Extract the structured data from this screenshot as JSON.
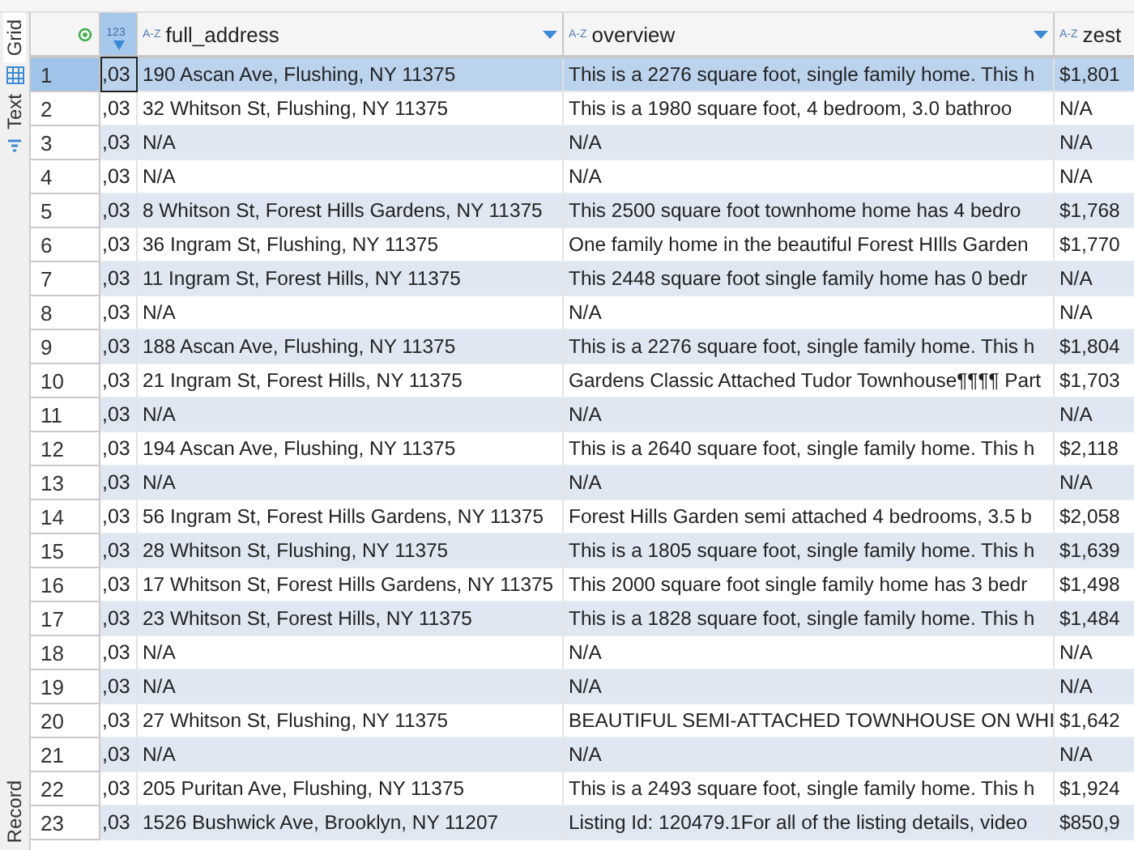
{
  "side_tabs": [
    {
      "label": "Grid",
      "selected": true
    },
    {
      "label": "Text",
      "selected": false
    },
    {
      "label": "Record",
      "selected": false
    }
  ],
  "table": {
    "columns": [
      {
        "kind": "number",
        "type_label": "123"
      },
      {
        "kind": "text",
        "type_label": "A-Z",
        "name": "full_address"
      },
      {
        "kind": "text",
        "type_label": "A-Z",
        "name": "overview"
      },
      {
        "kind": "text",
        "type_label": "A-Z",
        "name": "zest"
      }
    ],
    "rows": [
      {
        "num": "1",
        "selected": true,
        "cells": [
          ",03",
          "190 Ascan Ave, Flushing, NY 11375",
          "This is a 2276 square foot, single family home. This h",
          "$1,801"
        ]
      },
      {
        "num": "2",
        "selected": false,
        "cells": [
          ",03",
          "32 Whitson St, Flushing, NY 11375",
          "This is a 1980 square foot, 4 bedroom, 3.0 bathroo",
          "N/A"
        ]
      },
      {
        "num": "3",
        "selected": false,
        "cells": [
          ",03",
          "N/A",
          "N/A",
          "N/A"
        ]
      },
      {
        "num": "4",
        "selected": false,
        "cells": [
          ",03",
          "N/A",
          "N/A",
          "N/A"
        ]
      },
      {
        "num": "5",
        "selected": false,
        "cells": [
          ",03",
          "8 Whitson St, Forest Hills Gardens, NY 11375",
          "This 2500 square foot townhome home has 4 bedro",
          "$1,768"
        ]
      },
      {
        "num": "6",
        "selected": false,
        "cells": [
          ",03",
          "36 Ingram St, Flushing, NY 11375",
          "One family home in the beautiful Forest HIlls Garden",
          "$1,770"
        ]
      },
      {
        "num": "7",
        "selected": false,
        "cells": [
          ",03",
          "11 Ingram St, Forest Hills, NY 11375",
          "This 2448 square foot single family home has 0 bedr",
          "N/A"
        ]
      },
      {
        "num": "8",
        "selected": false,
        "cells": [
          ",03",
          "N/A",
          "N/A",
          "N/A"
        ]
      },
      {
        "num": "9",
        "selected": false,
        "cells": [
          ",03",
          "188 Ascan Ave, Flushing, NY 11375",
          "This is a 2276 square foot, single family home. This h",
          "$1,804"
        ]
      },
      {
        "num": "10",
        "selected": false,
        "cells": [
          ",03",
          "21 Ingram St, Forest Hills, NY 11375",
          "Gardens Classic Attached Tudor Townhouse¶¶¶¶ Part",
          "$1,703"
        ]
      },
      {
        "num": "11",
        "selected": false,
        "cells": [
          ",03",
          "N/A",
          "N/A",
          "N/A"
        ]
      },
      {
        "num": "12",
        "selected": false,
        "cells": [
          ",03",
          "194 Ascan Ave, Flushing, NY 11375",
          "This is a 2640 square foot, single family home. This h",
          "$2,118"
        ]
      },
      {
        "num": "13",
        "selected": false,
        "cells": [
          ",03",
          "N/A",
          "N/A",
          "N/A"
        ]
      },
      {
        "num": "14",
        "selected": false,
        "cells": [
          ",03",
          "56 Ingram St, Forest Hills Gardens, NY 11375",
          "Forest Hills Garden semi attached 4 bedrooms, 3.5 b",
          "$2,058"
        ]
      },
      {
        "num": "15",
        "selected": false,
        "cells": [
          ",03",
          "28 Whitson St, Flushing, NY 11375",
          "This is a 1805 square foot, single family home. This h",
          "$1,639"
        ]
      },
      {
        "num": "16",
        "selected": false,
        "cells": [
          ",03",
          "17 Whitson St, Forest Hills Gardens, NY 11375",
          "This 2000 square foot single family home has 3 bedr",
          "$1,498"
        ]
      },
      {
        "num": "17",
        "selected": false,
        "cells": [
          ",03",
          "23 Whitson St, Forest Hills, NY 11375",
          "This is a 1828 square foot, single family home. This h",
          "$1,484"
        ]
      },
      {
        "num": "18",
        "selected": false,
        "cells": [
          ",03",
          "N/A",
          "N/A",
          "N/A"
        ]
      },
      {
        "num": "19",
        "selected": false,
        "cells": [
          ",03",
          "N/A",
          "N/A",
          "N/A"
        ]
      },
      {
        "num": "20",
        "selected": false,
        "cells": [
          ",03",
          "27 Whitson St, Flushing, NY 11375",
          "BEAUTIFUL SEMI-ATTACHED TOWNHOUSE ON WHI",
          "$1,642"
        ]
      },
      {
        "num": "21",
        "selected": false,
        "cells": [
          ",03",
          "N/A",
          "N/A",
          "N/A"
        ]
      },
      {
        "num": "22",
        "selected": false,
        "cells": [
          ",03",
          "205 Puritan Ave, Flushing, NY 11375",
          "This is a 2493 square foot, single family home. This h",
          "$1,924"
        ]
      },
      {
        "num": "23",
        "selected": false,
        "cells": [
          ",03",
          "1526 Bushwick Ave, Brooklyn, NY 11207",
          "Listing Id: 120479.1For all of the listing details, video",
          "$850,9"
        ]
      }
    ]
  }
}
